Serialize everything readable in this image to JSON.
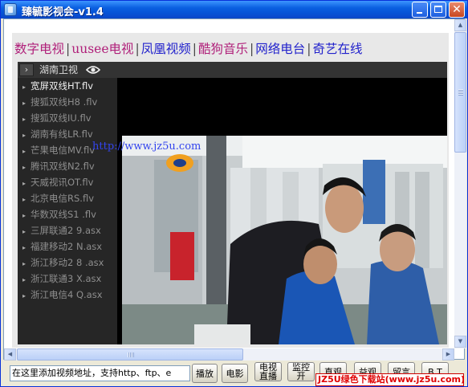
{
  "window": {
    "title": "臻毓影视会-v1.4",
    "close_glyph": "✕"
  },
  "channel_tabs": [
    {
      "label": "数字电视",
      "color": "#b0207a"
    },
    {
      "label": "uusee电视",
      "color": "#b0207a"
    },
    {
      "label": "凤凰视频",
      "color": "#2222cc"
    },
    {
      "label": "酷狗音乐",
      "color": "#b0207a"
    },
    {
      "label": "网络电台",
      "color": "#2222cc"
    },
    {
      "label": "奇艺在线",
      "color": "#2222cc"
    }
  ],
  "channel_separator": "|",
  "player": {
    "toggle_glyph": "›",
    "station": "湖南卫视",
    "watermark": "http://www.jz5u.com",
    "playlist_bullet": "▸",
    "playlist": [
      "宽屏双线HT.flv",
      "搜狐双线H8 .flv",
      "搜狐双线IU.flv",
      "湖南有线LR.flv",
      "芒果电信MV.flv",
      "腾讯双线N2.flv",
      "天威视讯OT.flv",
      "北京电信RS.flv",
      "华数双线S1 .flv",
      "三屏联通2 9.asx",
      "福建移动2 N.asx",
      "浙江移动2 8 .asx",
      "浙江联通3 X.asx",
      "浙江电信4 Q.asx"
    ],
    "active_index": 0
  },
  "scrollbars": {
    "up": "▲",
    "down": "▼",
    "left": "◀",
    "right": "▶"
  },
  "bottom": {
    "url_value": "在这里添加视频地址，支持http、ftp、e",
    "play": "播放",
    "movie": "电影",
    "tv_line1": "电视",
    "tv_line2": "直播",
    "monitor_line1": "监控",
    "monitor_line2": "开",
    "live": "直观",
    "youtube": "益观",
    "message": "留言",
    "bt": "B T",
    "banner": "JZ5U绿色下载站(www.jz5u.com)"
  }
}
